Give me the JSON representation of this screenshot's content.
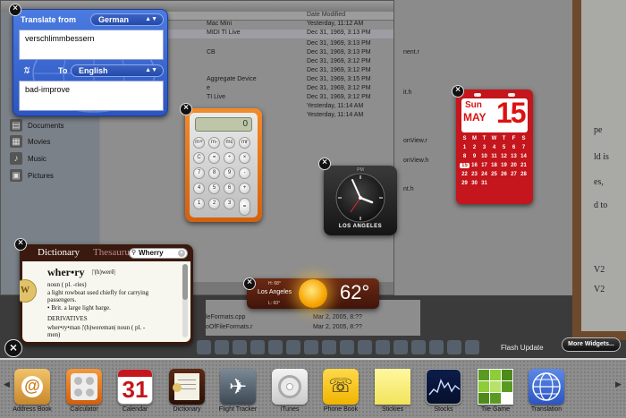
{
  "finder": {
    "col_modified": "Date Modified",
    "rows": [
      {
        "name": "Mac Mini",
        "date": "Yesterday, 11:12 AM"
      },
      {
        "name": "MIDI TI Live",
        "date": "Dec 31, 1969, 3:13 PM"
      },
      {
        "name": "",
        "date": "Dec 31, 1969, 3:13 PM"
      },
      {
        "name": "CB",
        "date": "Dec 31, 1969, 3:13 PM"
      },
      {
        "name": "",
        "date": "Dec 31, 1969, 3:12 PM"
      },
      {
        "name": "",
        "date": "Dec 31, 1969, 3:12 PM"
      },
      {
        "name": "Aggregate Device",
        "date": "Dec 31, 1969, 3:15 PM"
      },
      {
        "name": "e",
        "date": "Dec 31, 1969, 3:12 PM"
      },
      {
        "name": "TI Live",
        "date": "Dec 31, 1969, 3:12 PM"
      },
      {
        "name": "",
        "date": "Yesterday, 11:14 AM"
      },
      {
        "name": "",
        "date": "Yesterday, 11:14 AM"
      }
    ],
    "sidebar": [
      "Documents",
      "Movies",
      "Music",
      "Pictures"
    ]
  },
  "code_files": [
    "nent.r",
    "it.h",
    "onView.r",
    "onView.h",
    "nt.h"
  ],
  "doc_text": [
    "pe",
    "ld is",
    "es,",
    "d to",
    "V2",
    "V2"
  ],
  "bottom_files": [
    {
      "name": "leFormats.cpp",
      "date": "Mar 2, 2005, 8:??"
    },
    {
      "name": "oOfFileFormats.r",
      "date": "Mar 2, 2005, 8:??"
    }
  ],
  "translate": {
    "from_label": "Translate from",
    "from_lang": "German",
    "to_label": "To",
    "to_lang": "English",
    "input": "verschlimmbessern",
    "output": "bad-improve"
  },
  "calculator": {
    "display": "0",
    "keys": [
      "m+",
      "m-",
      "mc",
      "mr",
      "C",
      "=",
      "÷",
      "×",
      "7",
      "8",
      "9",
      "-",
      "4",
      "5",
      "6",
      "+",
      "1",
      "2",
      "3",
      "=",
      "0",
      ".",
      "c"
    ]
  },
  "clock": {
    "city": "LOS ANGELES",
    "ampm": "PM"
  },
  "calendar": {
    "dow": "Sun",
    "month": "MAY",
    "day": "15",
    "weekdays": [
      "S",
      "M",
      "T",
      "W",
      "T",
      "F",
      "S"
    ],
    "weeks": [
      [
        "1",
        "2",
        "3",
        "4",
        "5",
        "6",
        "7"
      ],
      [
        "8",
        "9",
        "10",
        "11",
        "12",
        "13",
        "14"
      ],
      [
        "15",
        "16",
        "17",
        "18",
        "19",
        "20",
        "21"
      ],
      [
        "22",
        "23",
        "24",
        "25",
        "26",
        "27",
        "28"
      ],
      [
        "29",
        "30",
        "31",
        "",
        "",
        "",
        ""
      ]
    ],
    "today": "15"
  },
  "weather": {
    "city": "Los Angeles",
    "temp": "62°",
    "hi": "H: 68°",
    "lo": "L: 60°"
  },
  "dictionary": {
    "tab_dictionary": "Dictionary",
    "tab_thesaurus": "Thesaurus",
    "search": "Wherry",
    "headword": "wher•ry",
    "pron": "|'(h)werē|",
    "pos": "noun ( pl. -ries)",
    "def1": "a light rowboat used chiefly for carrying",
    "def2": "passengers.",
    "def3": "• Brit. a large light barge.",
    "derivatives": "DERIVATIVES",
    "deriv1": "wher•ry•man |'(h)weremən| noun ( pl. -",
    "deriv2": "men)"
  },
  "flash_label": "Flash Update",
  "more_widgets": "More Widgets...",
  "widget_bar": [
    {
      "name": "Address Book"
    },
    {
      "name": "Calculator"
    },
    {
      "name": "Calendar"
    },
    {
      "name": "Dictionary"
    },
    {
      "name": "Flight Tracker"
    },
    {
      "name": "iTunes"
    },
    {
      "name": "Phone Book"
    },
    {
      "name": "Stickies"
    },
    {
      "name": "Stocks"
    },
    {
      "name": "Tile Game"
    },
    {
      "name": "Translation"
    }
  ],
  "widget_bar_calendar_day": "31",
  "colors": {
    "translate_blue": "#2c55c0",
    "calc_orange": "#e5731a",
    "calendar_red": "#c4161c",
    "dictionary_brown": "#3a1a0e"
  }
}
